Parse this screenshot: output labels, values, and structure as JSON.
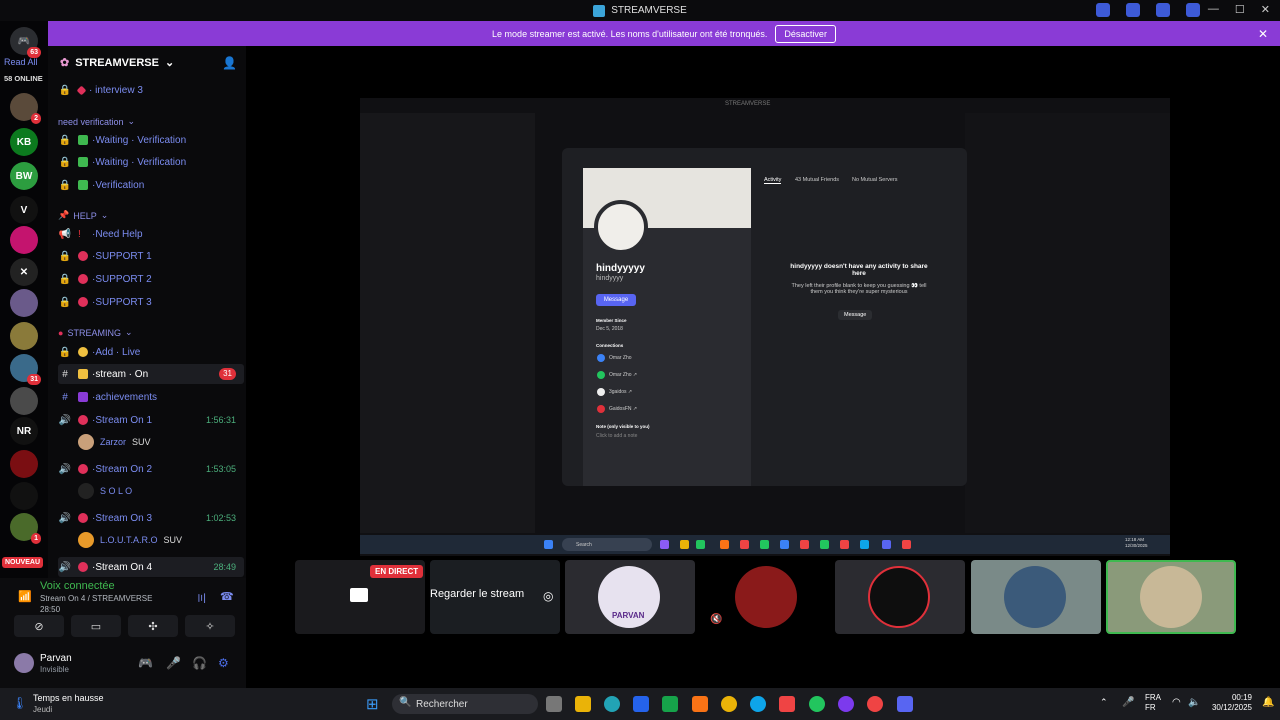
{
  "app": {
    "title": "STREAMVERSE"
  },
  "banner": {
    "text": "Le mode streamer est activé. Les noms d'utilisateur ont été tronqués.",
    "button": "Désactiver"
  },
  "rail": {
    "dm_badge": "63",
    "read_all": "Read All",
    "online": "58 ONLINE",
    "badge_2": "2",
    "badge_31": "31",
    "badge_1": "1",
    "new_label": "NOUVEAU",
    "nr": "NR"
  },
  "server": {
    "name": "STREAMVERSE"
  },
  "channels": {
    "interview": "interview 3",
    "cat_verify": "need verification",
    "waiting1": "Waiting",
    "waiting1b": "Verification",
    "waiting2": "Waiting",
    "waiting2b": "Verification",
    "verification": "Verification",
    "cat_help": "HELP",
    "need_help": "Need Help",
    "support1": "SUPPORT 1",
    "support2": "SUPPORT 2",
    "support3": "SUPPORT 3",
    "cat_streaming": "STREAMING",
    "add_live": "Add · Live",
    "stream_on": "stream · On",
    "stream_on_badge": "31",
    "achievements": "achievements",
    "s1": "Stream On 1",
    "s1_time": "1:56:31",
    "s1_user": "Zarzor",
    "s1_tag": "SUV",
    "s2": "Stream On 2",
    "s2_time": "1:53:05",
    "s2_user": "S O L O",
    "s3": "Stream On 3",
    "s3_time": "1:02:53",
    "s3_user": "L.O.U.T.A.R.O",
    "s3_tag": "SUV",
    "s4": "Stream On 4",
    "s4_time": "28:49"
  },
  "voice": {
    "title": "Voix connectée",
    "sub": "Stream On 4 / STREAMVERSE",
    "time": "28:50"
  },
  "user": {
    "name": "Parvan",
    "status": "Invisible"
  },
  "stream": {
    "inner_title": "STREAMVERSE",
    "profile_name": "hindyyyyy",
    "profile_handle": "hindyyyy",
    "message": "Message",
    "member_since_label": "Member Since",
    "member_since": "Dec 5, 2018",
    "connections_label": "Connections",
    "connections": [
      "Omar Zho",
      "Omar Zho ↗",
      "3gaidos ↗",
      "GaidosFN ↗"
    ],
    "note_label": "Note (only visible to you)",
    "note_placeholder": "Click to add a note",
    "tabs": [
      "Activity",
      "43 Mutual Friends",
      "No Mutual Servers"
    ],
    "activity_title": "hindyyyyy doesn't have any activity to share here",
    "activity_desc": "They left their profile blank to keep you guessing 👀 tell them you think they're super mysterious",
    "activity_msg": "Message",
    "inner_search": "Search",
    "inner_clock": "12:18 AM\n12/30/2025"
  },
  "thumbs": {
    "live": "EN DIRECT",
    "watch": "Regarder le stream",
    "parvan_label": "PARVAN"
  },
  "taskbar": {
    "weather_title": "Temps en hausse",
    "weather_sub": "Jeudi",
    "search": "Rechercher",
    "lang1": "FRA",
    "lang2": "FR",
    "time": "00:19",
    "date": "30/12/2025"
  },
  "colors": {
    "accent": "#8a3bd6",
    "blurple": "#5865f2",
    "live": "#e0303a",
    "green": "#3fb950"
  }
}
